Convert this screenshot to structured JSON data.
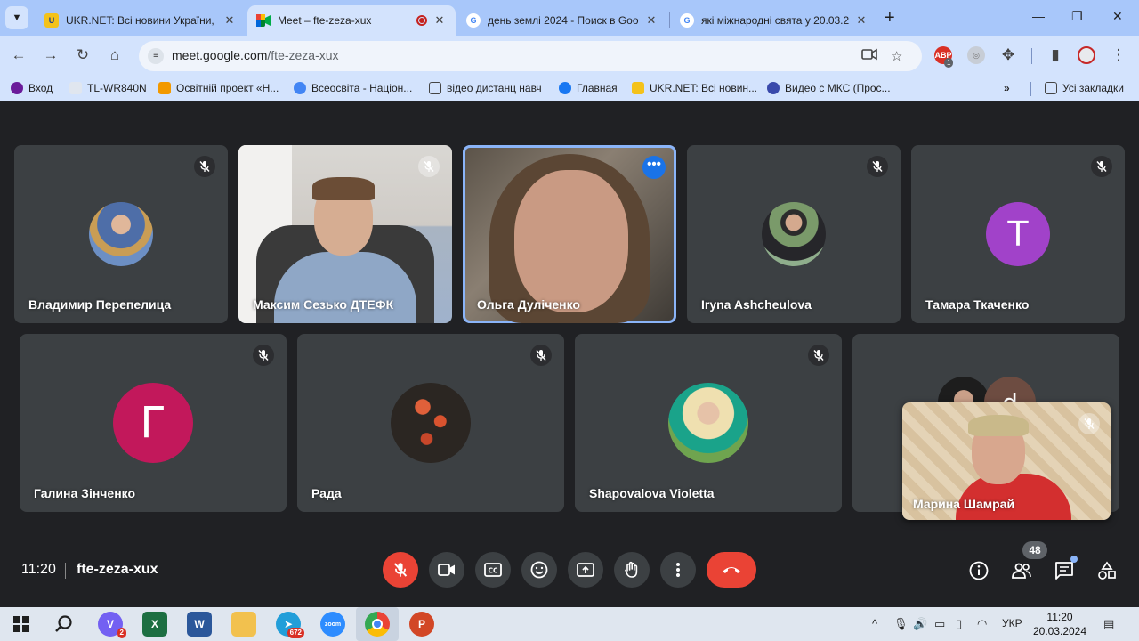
{
  "tabs": [
    {
      "title": "UKR.NET: Всі новини України, ",
      "active": false
    },
    {
      "title": "Meet – fte-zeza-xux",
      "active": true
    },
    {
      "title": "день землі 2024 - Поиск в Goo",
      "active": false
    },
    {
      "title": "які міжнародні свята у 20.03.2",
      "active": false
    }
  ],
  "address": {
    "host": "meet.google.com",
    "path": "/fte-zeza-xux"
  },
  "extension_badge": "1",
  "bookmarks": [
    "Вход",
    "TL-WR840N",
    "Освітній проект «Н...",
    "Всеосвіта - Націон...",
    "відео дистанц навч",
    "Главная",
    "UKR.NET: Всі новин...",
    "Видео с МКС (Прос..."
  ],
  "bookmarks_all": "Усі закладки",
  "participants": [
    {
      "name": "Владимир Перепелица",
      "muted": true,
      "avatar": "photo"
    },
    {
      "name": "Максим Сезько ДТЕФК",
      "muted": true,
      "avatar": "video"
    },
    {
      "name": "Ольга Дуліченко",
      "muted": false,
      "avatar": "video",
      "speaking": true
    },
    {
      "name": "Iryna Ashcheulova",
      "muted": true,
      "avatar": "photo"
    },
    {
      "name": "Тамара Ткаченко",
      "muted": true,
      "avatar": "letter",
      "letter": "Т",
      "color": "#a142c9"
    },
    {
      "name": "Галина Зінченко",
      "muted": true,
      "avatar": "letter",
      "letter": "Г",
      "color": "#c2185b"
    },
    {
      "name": "Рада",
      "muted": true,
      "avatar": "photo"
    },
    {
      "name": "Shapovalova Violetta",
      "muted": true,
      "avatar": "photo"
    },
    {
      "name": "",
      "muted": false,
      "avatar": "group",
      "letter": "d"
    }
  ],
  "self_view": {
    "name": "Марина Шамрай",
    "muted": true
  },
  "meeting": {
    "time": "11:20",
    "code": "fte-zeza-xux",
    "participant_count": "48"
  },
  "taskbar": {
    "time": "11:20",
    "date": "20.03.2024",
    "lang": "УКР",
    "telegram_badge": "672",
    "viber_badge": "2",
    "zoom_label": "zoom"
  },
  "colors": {
    "accent": "#8ab4f8",
    "hangup": "#ea4335",
    "chrome_frame": "#a8c7fa"
  }
}
